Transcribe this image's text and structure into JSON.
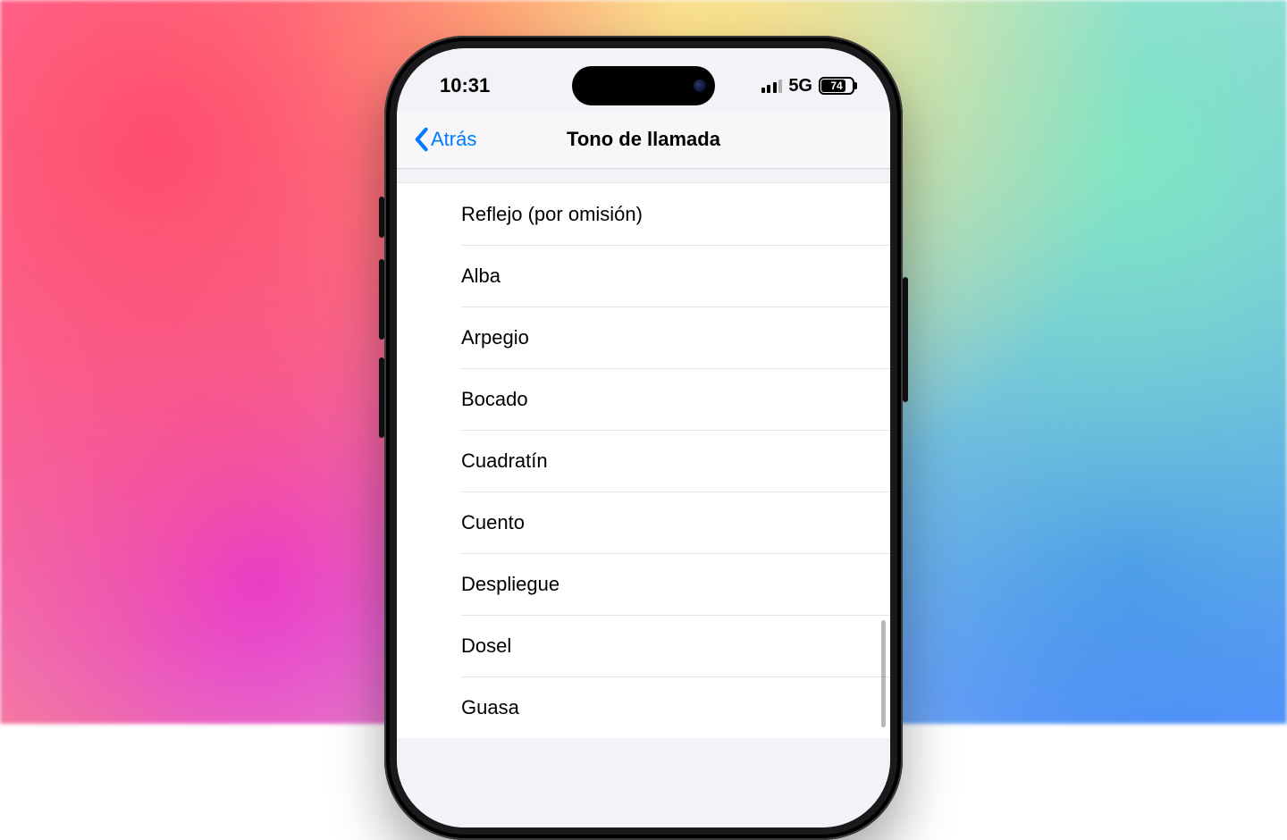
{
  "statusbar": {
    "time": "10:31",
    "network": "5G",
    "battery_pct": "74"
  },
  "navbar": {
    "back_label": "Atrás",
    "title": "Tono de llamada"
  },
  "ringtones": [
    {
      "label": "Reflejo (por omisión)"
    },
    {
      "label": "Alba"
    },
    {
      "label": "Arpegio"
    },
    {
      "label": "Bocado"
    },
    {
      "label": "Cuadratín"
    },
    {
      "label": "Cuento"
    },
    {
      "label": "Despliegue"
    },
    {
      "label": "Dosel"
    },
    {
      "label": "Guasa"
    }
  ]
}
